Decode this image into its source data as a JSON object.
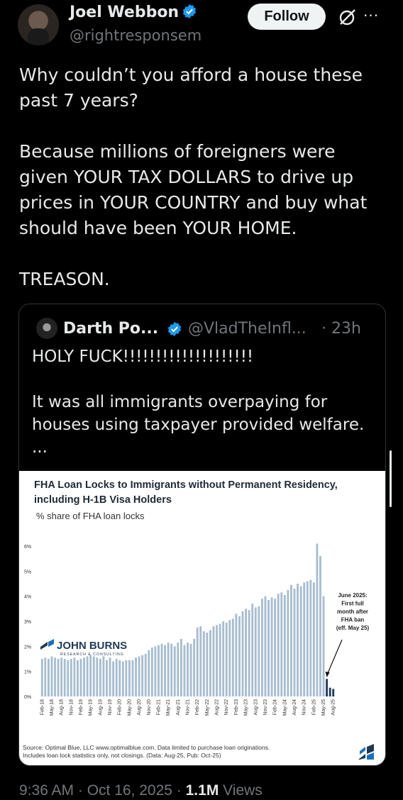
{
  "author": {
    "name": "Joel Webbon",
    "handle": "@rightresponsem",
    "follow_label": "Follow",
    "more_label": "···"
  },
  "tweet_text": "Why couldn’t you afford a house these past 7 years?\n\nBecause millions of foreigners were given YOUR TAX DOLLARS to drive up prices in YOUR COUNTRY and buy what should have been YOUR HOME.\n\nTREASON.",
  "quote": {
    "name": "Darth Po...",
    "handle": "@VladTheInfl...",
    "time": "· 23h",
    "text": "HOLY FUCK!!!!!!!!!!!!!!!!!!!!\n\nIt was all immigrants overpaying for houses using taxpayer provided welfare.\n...",
    "chart_title": "FHA Loan Locks to Immigrants without Permanent Residency, including H-1B Visa Holders",
    "chart_subtitle": "% share of FHA loan locks",
    "logo_text": "JOHN BURNS",
    "logo_subtext": "RESEARCH & CONSULTING",
    "annotation": [
      "June 2025:",
      "First full",
      "month after",
      "FHA ban",
      "(eff. May 25)"
    ],
    "source_line1": "Source: Optimal Blue, LLC www.optimalblue.com. Data limited to purchase loan originations.",
    "source_line2": "Includes loan lock statistics only, not closings. (Data: Aug-25, Pub: Oct-25)"
  },
  "footer": {
    "time": "9:36 AM · Oct 16, 2025 · ",
    "views_count": "1.1M",
    "views_label": " Views"
  },
  "colors": {
    "bar": "#a7bccf",
    "bar_highlight": "#1e3a56",
    "verified": "#1d9bf0"
  },
  "chart_data": {
    "type": "bar",
    "title": "FHA Loan Locks to Immigrants without Permanent Residency, including H-1B Visa Holders",
    "ylabel": "% share of FHA loan locks",
    "ylim": [
      0,
      6
    ],
    "ytick_labels": [
      "0%",
      "1%",
      "2%",
      "3%",
      "4%",
      "5%",
      "6%"
    ],
    "categories": [
      "Feb-18",
      "Mar-18",
      "Apr-18",
      "May-18",
      "Jun-18",
      "Jul-18",
      "Aug-18",
      "Sep-18",
      "Oct-18",
      "Nov-18",
      "Dec-18",
      "Jan-19",
      "Feb-19",
      "Mar-19",
      "Apr-19",
      "May-19",
      "Jun-19",
      "Jul-19",
      "Aug-19",
      "Sep-19",
      "Oct-19",
      "Nov-19",
      "Dec-19",
      "Jan-20",
      "Feb-20",
      "Mar-20",
      "Apr-20",
      "May-20",
      "Jun-20",
      "Jul-20",
      "Aug-20",
      "Sep-20",
      "Oct-20",
      "Nov-20",
      "Dec-20",
      "Jan-21",
      "Feb-21",
      "Mar-21",
      "Apr-21",
      "May-21",
      "Jun-21",
      "Jul-21",
      "Aug-21",
      "Sep-21",
      "Oct-21",
      "Nov-21",
      "Dec-21",
      "Jan-22",
      "Feb-22",
      "Mar-22",
      "Apr-22",
      "May-22",
      "Jun-22",
      "Jul-22",
      "Aug-22",
      "Sep-22",
      "Oct-22",
      "Nov-22",
      "Dec-22",
      "Jan-23",
      "Feb-23",
      "Mar-23",
      "Apr-23",
      "May-23",
      "Jun-23",
      "Jul-23",
      "Aug-23",
      "Sep-23",
      "Oct-23",
      "Nov-23",
      "Dec-23",
      "Jan-24",
      "Feb-24",
      "Mar-24",
      "Apr-24",
      "May-24",
      "Jun-24",
      "Jul-24",
      "Aug-24",
      "Sep-24",
      "Oct-24",
      "Nov-24",
      "Dec-24",
      "Jan-25",
      "Feb-25",
      "Mar-25",
      "Apr-25",
      "May-25",
      "Jun-25",
      "Jul-25",
      "Aug-25"
    ],
    "xtick_labels": [
      "Feb-18",
      "May-18",
      "Aug-18",
      "Nov-18",
      "Feb-19",
      "May-19",
      "Aug-19",
      "Nov-19",
      "Feb-20",
      "May-20",
      "Aug-20",
      "Nov-20",
      "Feb-21",
      "May-21",
      "Aug-21",
      "Nov-21",
      "Feb-22",
      "May-22",
      "Aug-22",
      "Nov-22",
      "Feb-23",
      "May-23",
      "Aug-23",
      "Nov-23",
      "Feb-24",
      "May-24",
      "Aug-24",
      "Nov-24",
      "Feb-25",
      "May-25",
      "Aug-25"
    ],
    "values": [
      1.5,
      1.55,
      1.5,
      1.6,
      1.55,
      1.5,
      1.55,
      1.5,
      1.45,
      1.5,
      1.55,
      1.45,
      1.5,
      1.55,
      1.6,
      1.65,
      1.6,
      1.55,
      1.5,
      1.6,
      1.45,
      1.55,
      1.4,
      1.5,
      1.45,
      1.4,
      1.45,
      1.45,
      1.45,
      1.55,
      1.6,
      1.65,
      1.7,
      1.85,
      1.95,
      2.0,
      2.05,
      2.1,
      2.05,
      2.15,
      2.1,
      2.0,
      2.15,
      2.3,
      2.05,
      2.15,
      2.1,
      2.3,
      2.75,
      2.8,
      2.6,
      2.55,
      2.65,
      2.8,
      2.85,
      2.9,
      3.0,
      2.95,
      3.05,
      3.1,
      3.3,
      3.2,
      3.4,
      3.5,
      3.45,
      3.7,
      3.55,
      3.6,
      3.9,
      4.0,
      3.85,
      3.95,
      3.9,
      4.1,
      4.15,
      4.05,
      4.25,
      4.45,
      4.3,
      4.5,
      4.4,
      4.55,
      4.6,
      4.65,
      4.55,
      6.1,
      5.6,
      4.0,
      0.7,
      0.35,
      0.3
    ],
    "highlight_from": "Jun-25",
    "annotation": "June 2025: First full month after FHA ban (eff. May 25)",
    "grid": false
  }
}
